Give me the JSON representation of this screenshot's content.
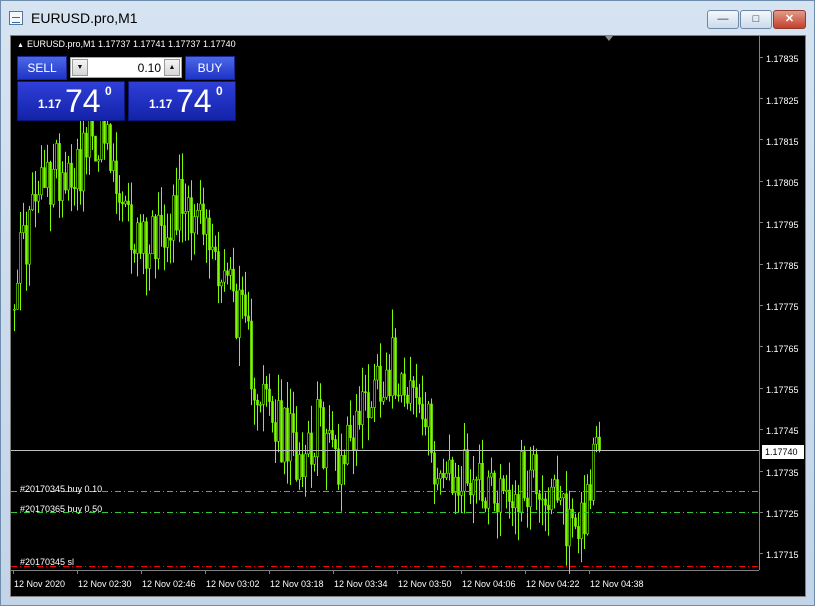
{
  "window": {
    "title": "EURUSD.pro,M1",
    "controls": {
      "minimize": "—",
      "maximize": "□",
      "close": "✕"
    }
  },
  "chart_header": {
    "symbol_line": "EURUSD.pro,M1  1.17737 1.17741 1.17737 1.17740"
  },
  "trade_panel": {
    "sell_label": "SELL",
    "buy_label": "BUY",
    "lot_value": "0.10",
    "sell_price": {
      "prefix": "1.17",
      "big": "74",
      "sup": "0"
    },
    "buy_price": {
      "prefix": "1.17",
      "big": "74",
      "sup": "0"
    }
  },
  "orders": [
    {
      "label": "#20170345 buy 0.10",
      "price": 1.1773,
      "style": "green-dashdot"
    },
    {
      "label": "#20170365 buy 0.50",
      "price": 1.17725,
      "style": "green-dashdot"
    },
    {
      "label": "#20170345 sl",
      "price": 1.17712,
      "style": "red-dashdot"
    }
  ],
  "price_scale": [
    "1.17835",
    "1.17825",
    "1.17815",
    "1.17805",
    "1.17795",
    "1.17785",
    "1.17775",
    "1.17765",
    "1.17755",
    "1.17745",
    "1.17735",
    "1.17725",
    "1.17715"
  ],
  "current_price": "1.17740",
  "time_scale": [
    "12 Nov 2020",
    "12 Nov 02:30",
    "12 Nov 02:46",
    "12 Nov 03:02",
    "12 Nov 03:18",
    "12 Nov 03:34",
    "12 Nov 03:50",
    "12 Nov 04:06",
    "12 Nov 04:22",
    "12 Nov 04:38"
  ],
  "colors": {
    "candle": "#7cfc00",
    "background": "#000000",
    "order_line": "#32cd32",
    "sl_line": "#ff0000",
    "bid_line": "#c0c0c0"
  },
  "chart_data": {
    "type": "candlestick",
    "symbol": "EURUSD.pro",
    "timeframe": "M1",
    "ylim": [
      1.17711,
      1.1784
    ],
    "x": [
      "12 Nov 2020",
      "12 Nov 02:30",
      "12 Nov 02:46",
      "12 Nov 03:02",
      "12 Nov 03:18",
      "12 Nov 03:34",
      "12 Nov 03:50",
      "12 Nov 04:06",
      "12 Nov 04:22",
      "12 Nov 04:38"
    ],
    "close": [
      1.17782,
      1.178,
      1.17808,
      1.1781,
      1.17818,
      1.17795,
      1.1779,
      1.17797,
      1.17802,
      1.1779,
      1.1778,
      1.1776,
      1.17745,
      1.1774,
      1.17745,
      1.17738,
      1.1775,
      1.1776,
      1.1776,
      1.17745,
      1.1773,
      1.17735,
      1.17732,
      1.1773,
      1.17735,
      1.17725,
      1.17722,
      1.1774
    ],
    "grid": false
  }
}
